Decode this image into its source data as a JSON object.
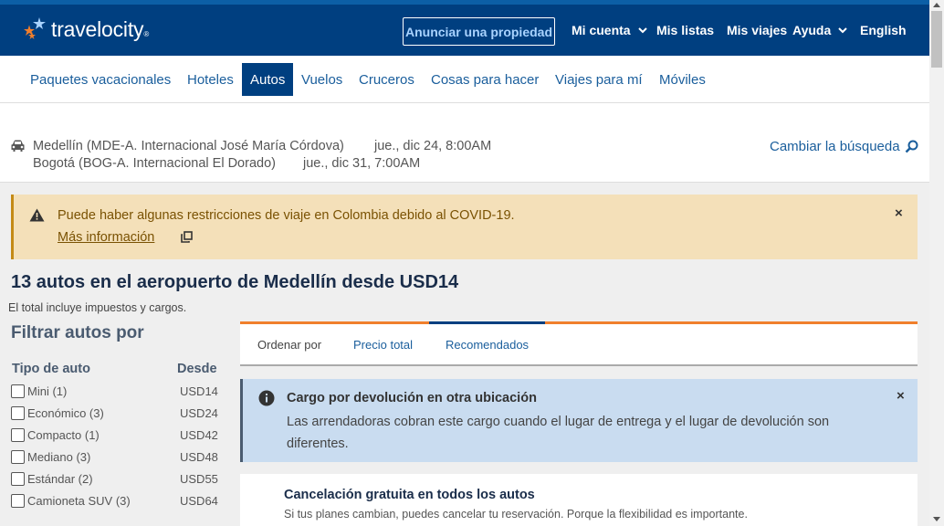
{
  "header": {
    "logo_text": "travelocity",
    "logo_tm": "®",
    "advertise": "Anunciar una propiedad",
    "nav": [
      "Mi cuenta",
      "Mis listas",
      "Mis viajes",
      "Ayuda",
      "English"
    ]
  },
  "subnav": [
    "Paquetes vacacionales",
    "Hoteles",
    "Autos",
    "Vuelos",
    "Cruceros",
    "Cosas para hacer",
    "Viajes para mí",
    "Móviles"
  ],
  "subnav_active": "Autos",
  "search": {
    "pickup_location": "Medellín (MDE-A. Internacional José María Córdova)",
    "pickup_time": "jue., dic 24, 8:00AM",
    "dropoff_location": "Bogotá (BOG-A. Internacional El Dorado)",
    "dropoff_time": "jue., dic 31, 7:00AM",
    "change_label": "Cambiar la búsqueda"
  },
  "covid": {
    "text": "Puede haber algunas restricciones de viaje en Colombia debido al COVID-19.",
    "link": "Más información"
  },
  "results": {
    "title": "13 autos en el aeropuerto de Medellín desde USD14",
    "subtitle": "El total incluye impuestos y cargos."
  },
  "filters": {
    "title": "Filtrar autos por",
    "type_header": "Tipo de auto",
    "price_header": "Desde",
    "items": [
      {
        "label": "Mini (1)",
        "price": "USD14"
      },
      {
        "label": "Económico (3)",
        "price": "USD24"
      },
      {
        "label": "Compacto (1)",
        "price": "USD42"
      },
      {
        "label": "Mediano (3)",
        "price": "USD48"
      },
      {
        "label": "Estándar (2)",
        "price": "USD55"
      },
      {
        "label": "Camioneta SUV (3)",
        "price": "USD64"
      }
    ]
  },
  "sort": {
    "label": "Ordenar por",
    "options": [
      "Precio total",
      "Recomendados"
    ],
    "active": "Recomendados"
  },
  "info": {
    "title": "Cargo por devolución en otra ubicación",
    "text": "Las arrendadoras cobran este cargo cuando el lugar de entrega y el lugar de devolución son diferentes."
  },
  "cancel": {
    "title": "Cancelación gratuita en todos los autos",
    "text": "Si tus planes cambian, puedes cancelar tu reservación. Porque la flexibilidad es importante."
  },
  "colors": {
    "header_bg": "#003f80",
    "link": "#1a5e9c",
    "accent_orange": "#f07f2c",
    "covid_bg": "#f4e0b9",
    "info_bg": "#c9dcf0"
  },
  "icons": {
    "close": "×"
  }
}
